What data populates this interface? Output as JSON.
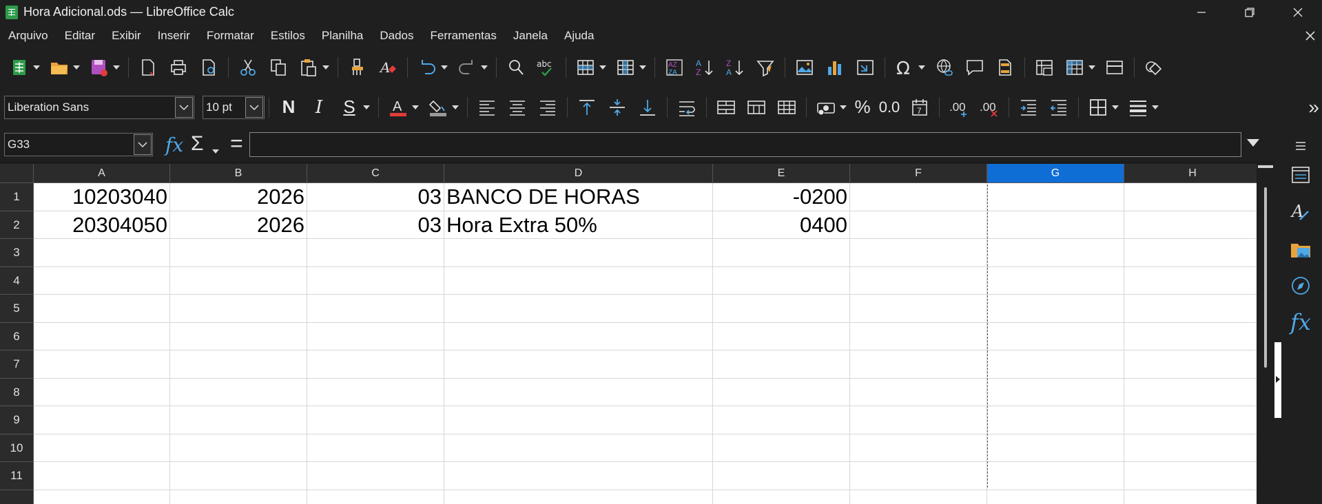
{
  "window": {
    "title": "Hora Adicional.ods — LibreOffice Calc"
  },
  "menu": [
    {
      "label": "Arquivo"
    },
    {
      "label": "Editar"
    },
    {
      "label": "Exibir"
    },
    {
      "label": "Inserir"
    },
    {
      "label": "Formatar"
    },
    {
      "label": "Estilos"
    },
    {
      "label": "Planilha"
    },
    {
      "label": "Dados"
    },
    {
      "label": "Ferramentas"
    },
    {
      "label": "Janela"
    },
    {
      "label": "Ajuda"
    }
  ],
  "format_toolbar": {
    "font_name": "Liberation Sans",
    "font_size": "10 pt",
    "bold_label": "N",
    "italic_label": "I",
    "underline_label": "S",
    "percent_label": "%",
    "decimal_label": "0.0",
    "add_decimal_label": ".00",
    "del_decimal_label": ".00"
  },
  "formula_bar": {
    "name_box": "G33",
    "fx_label": "fx",
    "sum_label": "Σ",
    "equals_label": "=",
    "content": ""
  },
  "sheet": {
    "columns": [
      "A",
      "B",
      "C",
      "D",
      "E",
      "F",
      "G",
      "H"
    ],
    "selected_column": "G",
    "rows": [
      "1",
      "2",
      "3",
      "4",
      "5",
      "6",
      "7",
      "8",
      "9",
      "10",
      "11"
    ],
    "cells": [
      [
        "10203040",
        "2026",
        "03",
        "BANCO DE HORAS",
        "-0200",
        "",
        "",
        ""
      ],
      [
        "20304050",
        "2026",
        "03",
        "Hora Extra 50%",
        "0400",
        "",
        "",
        ""
      ]
    ]
  },
  "colors": {
    "selected_header": "#0f6dd6",
    "chrome": "#1f1f1f",
    "accent_icon": "#4fa8e8"
  },
  "sidebar": {
    "fx_label": "fx"
  }
}
